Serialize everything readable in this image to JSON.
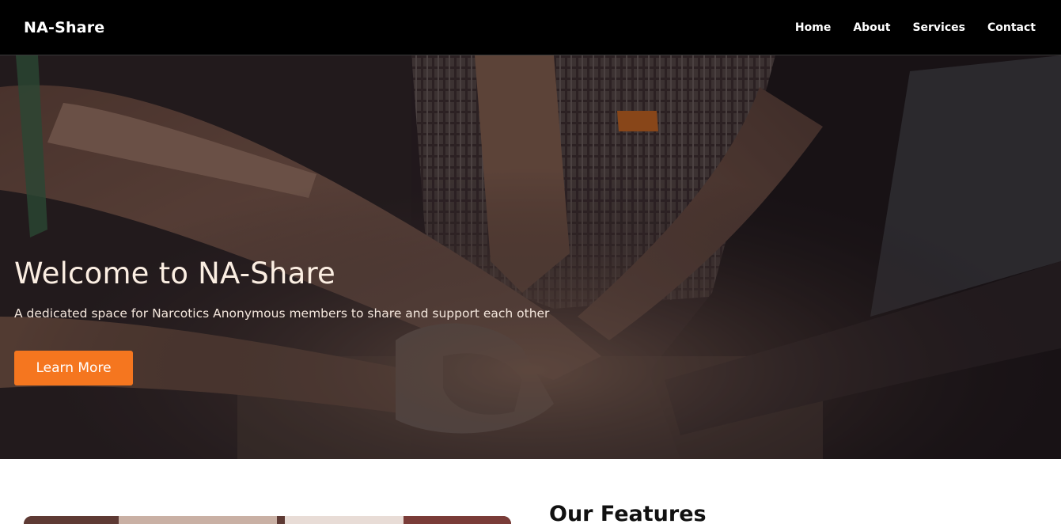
{
  "header": {
    "brand": "NA-Share",
    "nav": [
      "Home",
      "About",
      "Services",
      "Contact"
    ]
  },
  "hero": {
    "title": "Welcome to NA-Share",
    "subtitle": "A dedicated space for Narcotics Anonymous members to share and support each other",
    "cta_label": "Learn More"
  },
  "features": {
    "title": "Our Features"
  },
  "colors": {
    "navbar_bg": "#000000",
    "accent": "#f5761f",
    "hero_text": "#fbeee2"
  }
}
